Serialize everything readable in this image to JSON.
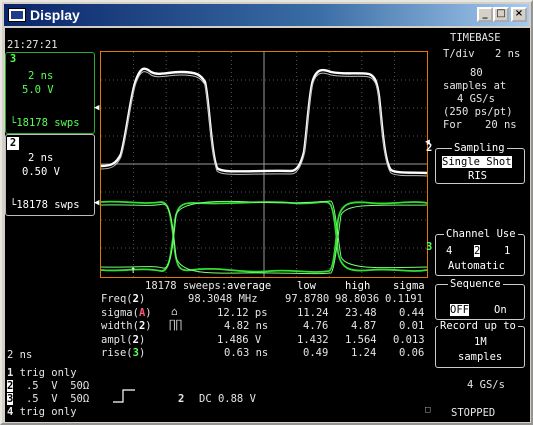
{
  "window": {
    "title": "Display"
  },
  "titlebar_buttons": {
    "minimize": "_",
    "maximize": "□",
    "close": "×"
  },
  "clock": "21:27:21",
  "channels": [
    {
      "num": "3",
      "tdiv": "2 ns",
      "vdiv": "5.0 V",
      "sweeps": "18178 swps",
      "color": "#55ff55"
    },
    {
      "num": "2",
      "tdiv": "2 ns",
      "vdiv": "0.50 V",
      "sweeps": "18178 swps",
      "color": "#ffffff"
    }
  ],
  "markers": {
    "ch2": "2",
    "ch3": "3"
  },
  "trigger_arrow": "↑",
  "timebase": {
    "heading": "TIMEBASE",
    "tdiv_label": "T/div",
    "tdiv_value": "2 ns",
    "samples": "80",
    "samples_at": "samples at",
    "rate": "4 GS/s",
    "ps_per_pt": "(250 ps/pt)",
    "for_label": "For",
    "for_value": "20 ns"
  },
  "sampling": {
    "label": "Sampling",
    "selected": "Single Shot",
    "other": "RIS"
  },
  "channel_use": {
    "label": "Channel Use",
    "options": [
      "4",
      "2",
      "1"
    ],
    "selected_index": 1,
    "mode": "Automatic"
  },
  "sequence": {
    "label": "Sequence",
    "off": "OFF",
    "on": "On"
  },
  "record": {
    "line1": "Record up to",
    "line2": "1M",
    "line3": "samples"
  },
  "sample_rate": "4 GS/s",
  "status": "STOPPED",
  "measurements": {
    "sweeps_label": "18178 sweeps:",
    "headers": [
      "average",
      "low",
      "high",
      "sigma"
    ],
    "rows": [
      {
        "name": "Freq(",
        "ch": "2",
        "avg": "98.3048 MHz",
        "low": "97.8780",
        "high": "98.8036",
        "sigma": "0.1191"
      },
      {
        "name": "sigma(",
        "ch": "A",
        "avg": "12.12 ps",
        "low": "11.24",
        "high": "23.48",
        "sigma": "0.44"
      },
      {
        "name": "width(",
        "ch": "2",
        "avg": "4.82 ns",
        "low": "4.76",
        "high": "4.87",
        "sigma": "0.01"
      },
      {
        "name": "ampl(",
        "ch": "2",
        "avg": "1.486 V",
        "low": "1.432",
        "high": "1.564",
        "sigma": "0.013"
      },
      {
        "name": "rise(",
        "ch": "3",
        "avg": "0.63 ns",
        "low": "0.49",
        "high": "1.24",
        "sigma": "0.06"
      }
    ]
  },
  "bottom_left": {
    "timediv": "2 ns",
    "trig_lines": [
      {
        "n": "1",
        "text": "trig only"
      },
      {
        "n": "2",
        "text": ".5  V  50Ω"
      },
      {
        "n": "3",
        "text": ".5  V  50Ω"
      },
      {
        "n": "4",
        "text": "trig only"
      }
    ],
    "trigger_ch": "2",
    "trigger_info": "DC 0.88 V"
  }
}
